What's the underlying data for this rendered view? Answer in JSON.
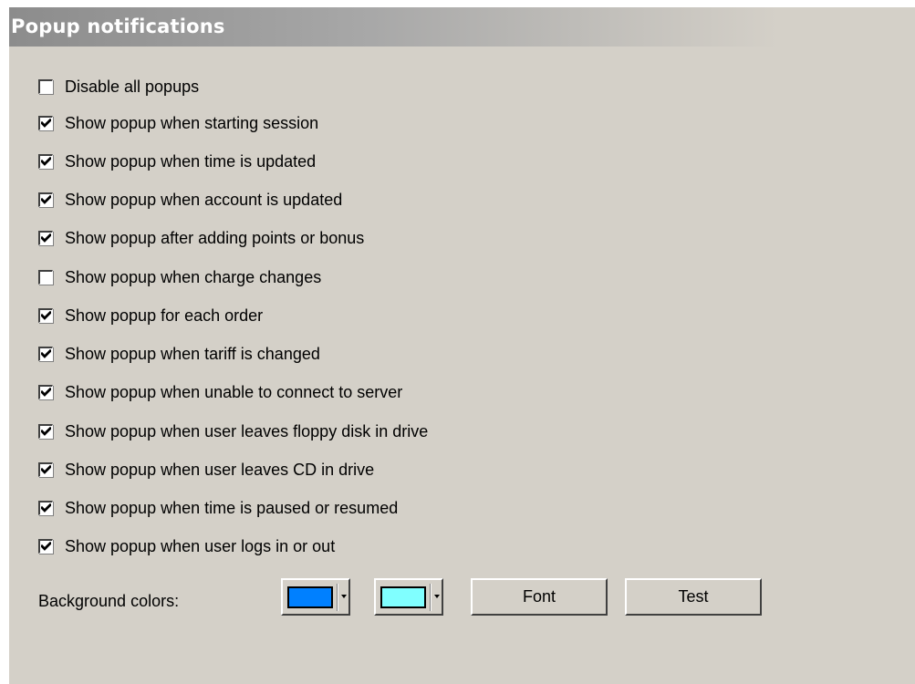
{
  "header": {
    "title": "Popup notifications"
  },
  "options": [
    {
      "label": "Disable all popups",
      "checked": false
    },
    {
      "label": "Show popup when starting session",
      "checked": true
    },
    {
      "label": "Show popup when time is updated",
      "checked": true
    },
    {
      "label": "Show popup when account is updated",
      "checked": true
    },
    {
      "label": "Show popup after adding points or bonus",
      "checked": true
    },
    {
      "label": "Show popup when charge changes",
      "checked": false
    },
    {
      "label": "Show popup for each order",
      "checked": true
    },
    {
      "label": "Show popup when tariff is changed",
      "checked": true
    },
    {
      "label": "Show popup when unable to connect to server",
      "checked": true
    },
    {
      "label": "Show popup when user leaves floppy disk in drive",
      "checked": true
    },
    {
      "label": "Show popup when user leaves CD in drive",
      "checked": true
    },
    {
      "label": "Show popup when time is paused or resumed",
      "checked": true
    },
    {
      "label": "Show popup when user logs in or out",
      "checked": true
    }
  ],
  "background": {
    "label": "Background colors:",
    "color1": "#0080ff",
    "color2": "#80ffff"
  },
  "buttons": {
    "font": "Font",
    "test": "Test"
  }
}
